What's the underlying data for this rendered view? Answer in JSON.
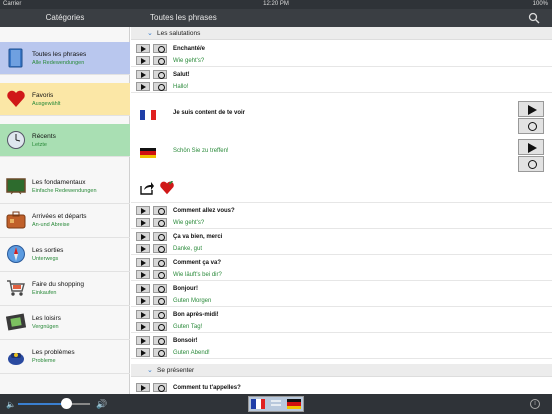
{
  "status": {
    "carrier": "Carrier",
    "time": "12:20 PM",
    "battery": "100%"
  },
  "nav": {
    "left_title": "Catégories",
    "right_title": "Toutes les phrases",
    "search_icon": "search-icon"
  },
  "categories": [
    {
      "fr": "Toutes les phrases",
      "de": "Alle Redewendungen",
      "icon": "book-icon",
      "bg": "#b9c7ee"
    },
    {
      "fr": "Favoris",
      "de": "Ausgewählt",
      "icon": "heart-icon",
      "bg": "#fbe7a6"
    },
    {
      "fr": "Récents",
      "de": "Letzte",
      "icon": "clock-icon",
      "bg": "#a9dfb3"
    },
    {
      "fr": "Les fondamentaux",
      "de": "Einfache Redewendungen",
      "icon": "blackboard-icon",
      "bg": ""
    },
    {
      "fr": "Arrivées et départs",
      "de": "An-und Abreise",
      "icon": "suitcase-icon",
      "bg": ""
    },
    {
      "fr": "Les sorties",
      "de": "Unterwegs",
      "icon": "compass-icon",
      "bg": ""
    },
    {
      "fr": "Faire du shopping",
      "de": "Einkaufen",
      "icon": "cart-icon",
      "bg": ""
    },
    {
      "fr": "Les loisirs",
      "de": "Vergnügen",
      "icon": "film-icon",
      "bg": ""
    },
    {
      "fr": "Les problèmes",
      "de": "Probleme",
      "icon": "police-icon",
      "bg": ""
    }
  ],
  "sections": [
    {
      "label": "Les salutations"
    },
    {
      "label": "Se présenter"
    }
  ],
  "phrases_before": [
    {
      "fr": "Enchanté/e",
      "de": "Wie geht's?"
    },
    {
      "fr": "Salut!",
      "de": "Hallo!"
    }
  ],
  "expanded": {
    "fr": "Je suis content de te voir",
    "de": "Schön Sie zu treffen!"
  },
  "phrases_after": [
    {
      "fr": "Comment allez vous?",
      "de": "Wie geht's?"
    },
    {
      "fr": "Ça va bien, merci",
      "de": "Danke, gut"
    },
    {
      "fr": "Comment ça va?",
      "de": "Wie läuft's bei dir?"
    },
    {
      "fr": "Bonjour!",
      "de": "Guten Morgen"
    },
    {
      "fr": "Bon après-midi!",
      "de": "Guten Tag!"
    },
    {
      "fr": "Bonsoir!",
      "de": "Guten Abend!"
    }
  ],
  "section2_phrase": {
    "fr": "Comment tu t'appelles?"
  },
  "volume": {
    "level": 0.68
  },
  "colors": {
    "accent": "#3a7fd0",
    "german_text": "#2a8a3a"
  }
}
